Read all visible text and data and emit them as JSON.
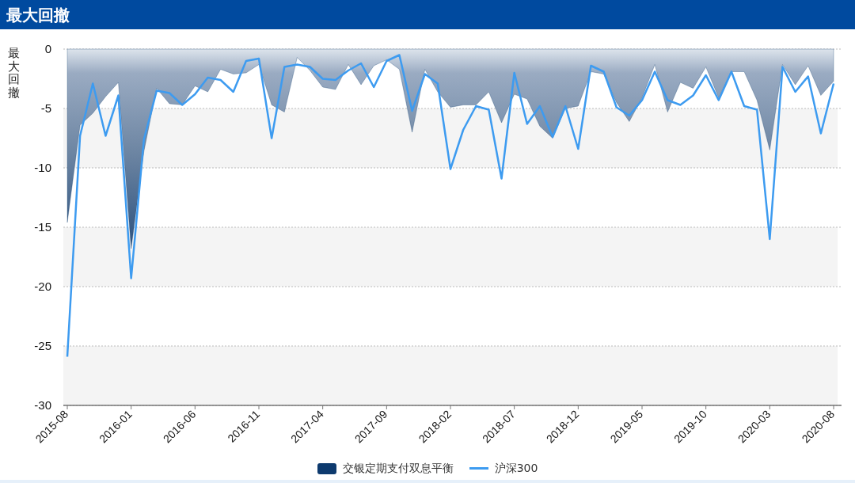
{
  "header": {
    "title": "最大回撤"
  },
  "chart": {
    "chart_data": {
      "type": "area",
      "ylabel": "最大回撤",
      "categories": [
        "2015-08",
        null,
        null,
        null,
        null,
        "2016-01",
        null,
        null,
        null,
        null,
        "2016-06",
        null,
        null,
        null,
        null,
        "2016-11",
        null,
        null,
        null,
        null,
        "2017-04",
        null,
        null,
        null,
        null,
        "2017-09",
        null,
        null,
        null,
        null,
        "2018-02",
        null,
        null,
        null,
        null,
        "2018-07",
        null,
        null,
        null,
        null,
        "2018-12",
        null,
        null,
        null,
        null,
        "2019-05",
        null,
        null,
        null,
        null,
        "2019-10",
        null,
        null,
        null,
        null,
        "2020-03",
        null,
        null,
        null,
        null,
        "2020-08"
      ],
      "series": [
        {
          "name": "交银定期支付双息平衡",
          "type": "area",
          "color": "#0d3a6e",
          "values": [
            -14.6,
            -6.4,
            -5.4,
            -4.0,
            -2.8,
            -16.8,
            -8.6,
            -3.3,
            -4.6,
            -4.7,
            -3.1,
            -3.6,
            -1.7,
            -2.1,
            -2.0,
            -1.3,
            -4.7,
            -5.3,
            -0.7,
            -1.8,
            -3.2,
            -3.4,
            -1.3,
            -3.0,
            -1.4,
            -0.9,
            -1.7,
            -7.0,
            -1.7,
            -3.6,
            -4.9,
            -4.7,
            -4.7,
            -3.6,
            -6.2,
            -3.8,
            -4.2,
            -6.5,
            -7.5,
            -5.0,
            -4.8,
            -1.9,
            -2.1,
            -4.5,
            -6.1,
            -4.1,
            -1.3,
            -5.3,
            -2.8,
            -3.3,
            -1.5,
            -4.1,
            -1.9,
            -1.9,
            -4.3,
            -8.5,
            -1.3,
            -3.0,
            -1.4,
            -3.9,
            -2.7
          ]
        },
        {
          "name": "沪深300",
          "type": "line",
          "color": "#3d9bf0",
          "values": [
            -25.9,
            -7.3,
            -2.9,
            -7.3,
            -3.9,
            -19.3,
            -7.6,
            -3.5,
            -3.7,
            -4.7,
            -3.8,
            -2.4,
            -2.6,
            -3.6,
            -1.0,
            -0.8,
            -7.5,
            -1.5,
            -1.3,
            -1.5,
            -2.5,
            -2.6,
            -1.8,
            -1.2,
            -3.2,
            -1.0,
            -0.5,
            -5.2,
            -2.1,
            -2.9,
            -10.1,
            -6.8,
            -4.8,
            -5.1,
            -10.9,
            -2.0,
            -6.3,
            -4.8,
            -7.4,
            -4.8,
            -8.4,
            -1.4,
            -1.9,
            -4.9,
            -5.6,
            -4.3,
            -1.9,
            -4.3,
            -4.7,
            -3.9,
            -2.2,
            -4.3,
            -1.9,
            -4.8,
            -5.1,
            -16.0,
            -1.5,
            -3.6,
            -2.3,
            -7.1,
            -2.9
          ]
        }
      ],
      "ylim": [
        -30,
        0
      ],
      "grid": true,
      "yticks": [
        0,
        -5,
        -10,
        -15,
        -20,
        -25,
        -30
      ]
    }
  }
}
